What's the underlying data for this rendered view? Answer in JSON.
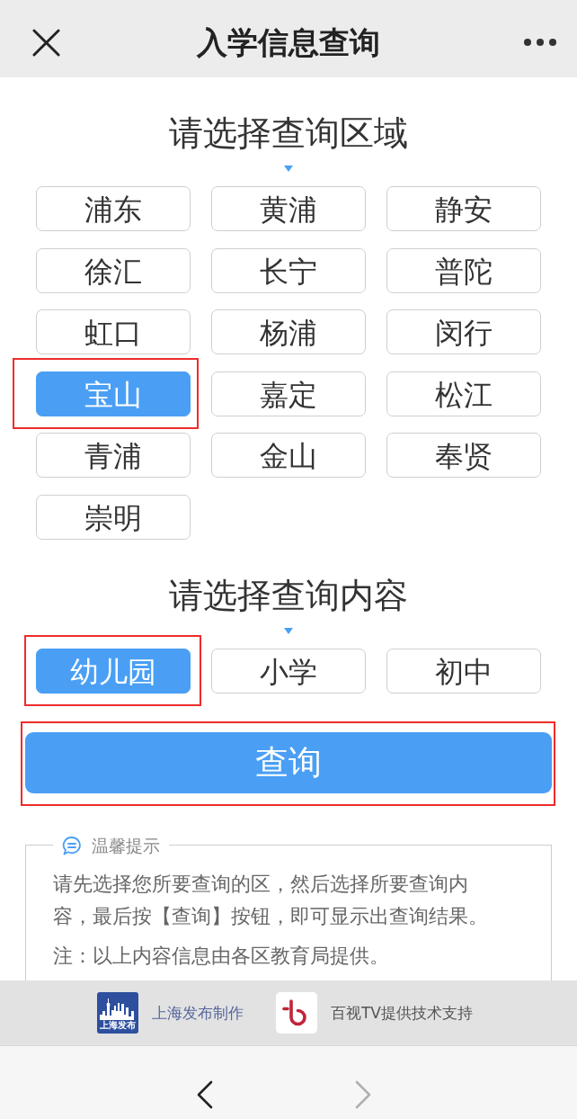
{
  "nav_bar": {
    "title": "入学信息查询"
  },
  "region_section": {
    "title": "请选择查询区域",
    "options": [
      {
        "label": "浦东",
        "selected": false,
        "highlighted": false
      },
      {
        "label": "黄浦",
        "selected": false,
        "highlighted": false
      },
      {
        "label": "静安",
        "selected": false,
        "highlighted": false
      },
      {
        "label": "徐汇",
        "selected": false,
        "highlighted": false
      },
      {
        "label": "长宁",
        "selected": false,
        "highlighted": false
      },
      {
        "label": "普陀",
        "selected": false,
        "highlighted": false
      },
      {
        "label": "虹口",
        "selected": false,
        "highlighted": false
      },
      {
        "label": "杨浦",
        "selected": false,
        "highlighted": false
      },
      {
        "label": "闵行",
        "selected": false,
        "highlighted": false
      },
      {
        "label": "宝山",
        "selected": true,
        "highlighted": true
      },
      {
        "label": "嘉定",
        "selected": false,
        "highlighted": false
      },
      {
        "label": "松江",
        "selected": false,
        "highlighted": false
      },
      {
        "label": "青浦",
        "selected": false,
        "highlighted": false
      },
      {
        "label": "金山",
        "selected": false,
        "highlighted": false
      },
      {
        "label": "奉贤",
        "selected": false,
        "highlighted": false
      },
      {
        "label": "崇明",
        "selected": false,
        "highlighted": false
      }
    ]
  },
  "content_section": {
    "title": "请选择查询内容",
    "options": [
      {
        "label": "幼儿园",
        "selected": true,
        "highlighted": true
      },
      {
        "label": "小学",
        "selected": false,
        "highlighted": false
      },
      {
        "label": "初中",
        "selected": false,
        "highlighted": false
      }
    ]
  },
  "query_button": {
    "label": "查询",
    "highlighted": true
  },
  "tip": {
    "title": "温馨提示",
    "paragraphs": [
      "请先选择您所要查询的区，然后选择所要查询内容，最后按【查询】按钮，即可显示出查询结果。",
      "注：以上内容信息由各区教育局提供。"
    ]
  },
  "footer": {
    "credits": [
      {
        "kind": "publisher",
        "logo_text": "上海发布",
        "text": "上海发布制作"
      },
      {
        "kind": "tech",
        "text": "百视TV提供技术支持"
      }
    ]
  },
  "browser_nav": {
    "back": {
      "disabled": false
    },
    "forward": {
      "disabled": true
    }
  }
}
